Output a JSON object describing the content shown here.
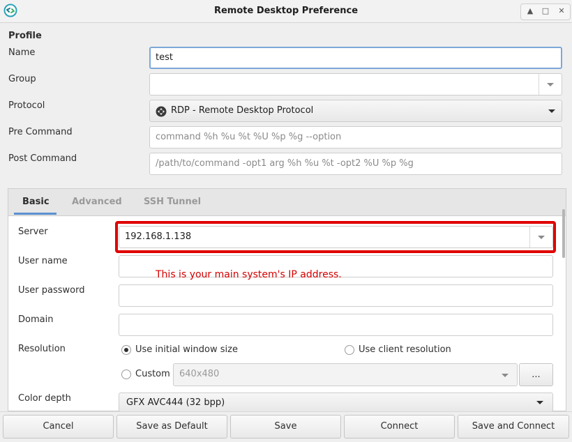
{
  "window": {
    "title": "Remote Desktop Preference"
  },
  "profile": {
    "section_title": "Profile",
    "name_label": "Name",
    "name_value": "test",
    "group_label": "Group",
    "group_value": "",
    "protocol_label": "Protocol",
    "protocol_value": "RDP - Remote Desktop Protocol",
    "pre_command_label": "Pre Command",
    "pre_command_placeholder": "command %h %u %t %U %p %g --option",
    "post_command_label": "Post Command",
    "post_command_placeholder": "/path/to/command -opt1 arg %h %u %t -opt2 %U %p %g"
  },
  "tabs": [
    {
      "label": "Basic",
      "active": true
    },
    {
      "label": "Advanced",
      "active": false
    },
    {
      "label": "SSH Tunnel",
      "active": false
    }
  ],
  "basic": {
    "server_label": "Server",
    "server_value": "192.168.1.138",
    "username_label": "User name",
    "username_value": "",
    "password_label": "User password",
    "password_value": "",
    "domain_label": "Domain",
    "domain_value": "",
    "resolution_label": "Resolution",
    "resolution_options": {
      "initial": "Use initial window size",
      "client": "Use client resolution",
      "custom": "Custom"
    },
    "resolution_selected": "initial",
    "custom_resolution_value": "640x480",
    "custom_more_label": "...",
    "color_depth_label": "Color depth",
    "color_depth_value": "GFX AVC444 (32 bpp)"
  },
  "annotation": {
    "text": "This is your main system's IP address.",
    "color": "#d40000"
  },
  "buttons": {
    "cancel": "Cancel",
    "save_default": "Save as Default",
    "save": "Save",
    "connect": "Connect",
    "save_connect": "Save and Connect"
  }
}
